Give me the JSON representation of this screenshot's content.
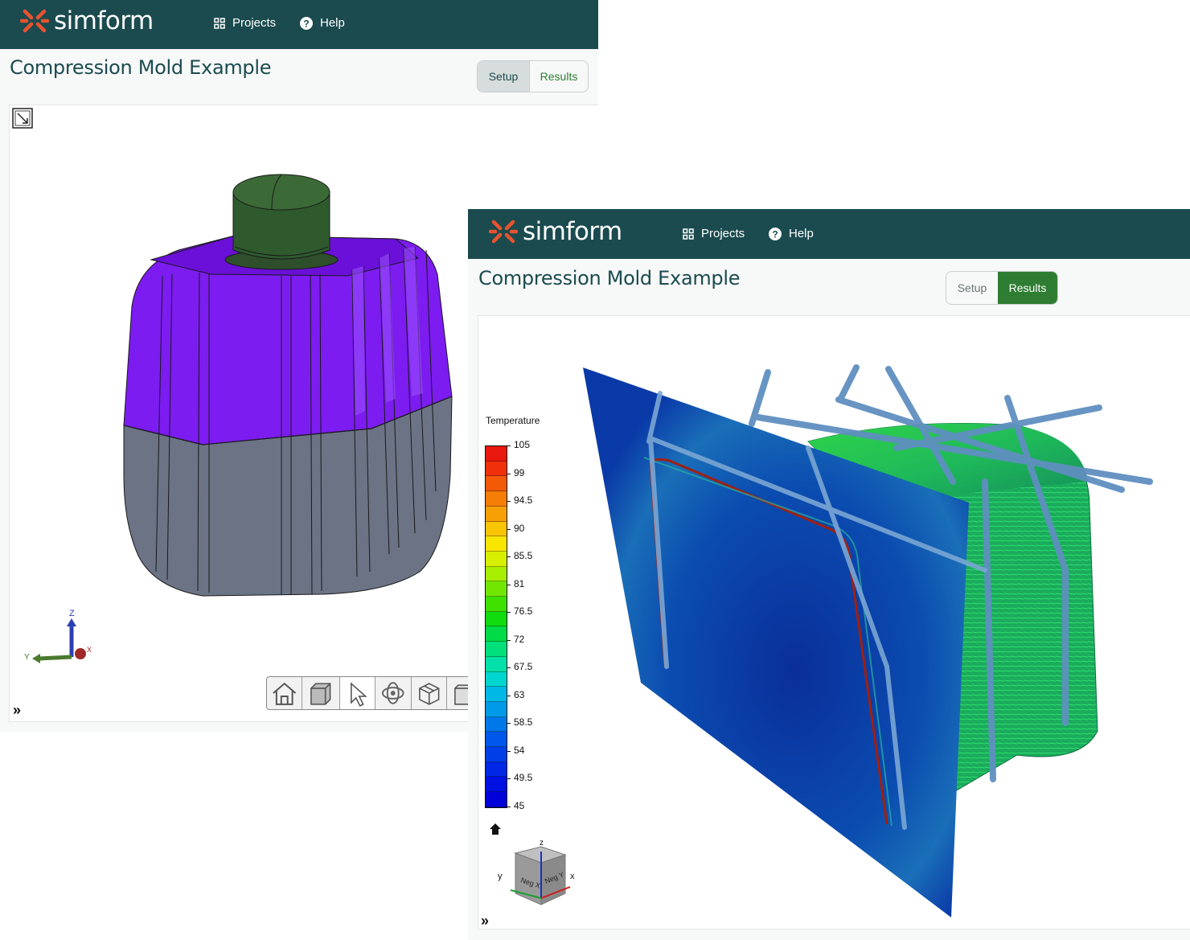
{
  "brand": {
    "name": "simform",
    "accent": "#e8532f",
    "navbar_color": "#1b4b4f"
  },
  "nav": {
    "projects": "Projects",
    "help": "Help"
  },
  "icons": {
    "projects": "grid-icon",
    "help": "question-circle-icon",
    "expand": "double-chevron-right-icon"
  },
  "page_title": "Compression Mold Example",
  "tabs": {
    "setup": "Setup",
    "results": "Results"
  },
  "window_setup": {
    "active_tab": "Setup"
  },
  "window_results": {
    "active_tab": "Results"
  },
  "toolbar": [
    "home-icon",
    "box-view-icon",
    "select-cursor-icon",
    "rotate-icon",
    "parts-icon",
    "front-view-icon"
  ],
  "triad": {
    "z": "Z",
    "y": "Y",
    "x": "X"
  },
  "legend": {
    "title": "Temperature",
    "labels": [
      "105",
      "99",
      "94.5",
      "90",
      "85.5",
      "81",
      "76.5",
      "72",
      "67.5",
      "63",
      "58.5",
      "54",
      "49.5",
      "45"
    ],
    "colors": [
      "#e8180e",
      "#f0300a",
      "#f25a08",
      "#f47e06",
      "#f7a004",
      "#f9c402",
      "#f9e600",
      "#d7f000",
      "#a8ee00",
      "#72e600",
      "#3ee000",
      "#10dc10",
      "#00dc48",
      "#00e07a",
      "#00e0aa",
      "#00d6d0",
      "#00b8e6",
      "#009ae8",
      "#0078ea",
      "#0058ea",
      "#003ee8",
      "#0026e6",
      "#0010e0",
      "#0000d8"
    ]
  },
  "viewcube": {
    "face_front": "Neg X",
    "face_side": "Neg Y",
    "axis_z": "z",
    "axis_y": "y",
    "axis_x": "x"
  }
}
